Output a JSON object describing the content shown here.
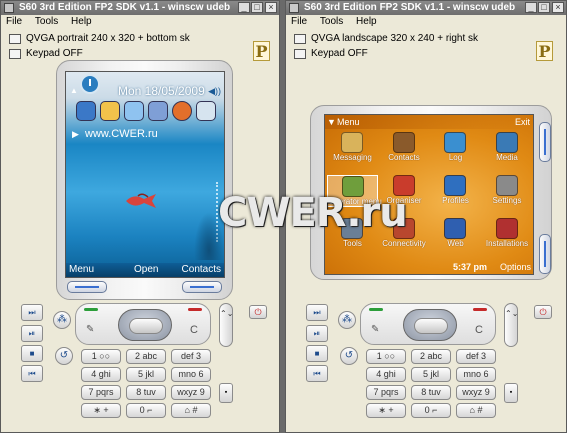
{
  "colors": {
    "titlebar": "#7a7a7a",
    "window_bg": "#ece9d8",
    "softkey_bar": "#0e5e97",
    "menu_orange": "#e08a14"
  },
  "menubar": {
    "file": "File",
    "tools": "Tools",
    "help": "Help"
  },
  "window_controls": {
    "minimize": "_",
    "maximize": "□",
    "close": "×"
  },
  "left_window": {
    "title": "S60 3rd Edition FP2 SDK v1.1 - winscw udeb",
    "mode": "QVGA portrait 240 x 320 + bottom sk",
    "keypad_status": "Keypad OFF",
    "logo": "P",
    "screen": {
      "date": "Mon 18/05/2009",
      "url": "www.CWER.ru",
      "softkeys": {
        "left": "Menu",
        "middle": "Open",
        "right": "Contacts"
      },
      "app_icons": [
        "messaging-icon",
        "contacts-icon",
        "calendar-icon",
        "music-icon",
        "firefox-icon",
        "gallery-icon"
      ]
    }
  },
  "right_window": {
    "title": "S60 3rd Edition FP2 SDK v1.1 - winscw udeb",
    "mode": "QVGA landscape 320 x 240 + right sk",
    "keypad_status": "Keypad OFF",
    "logo": "P",
    "screen": {
      "title": "Menu",
      "exit": "Exit",
      "time": "5:37 pm",
      "options": "Options",
      "selected": "Operator menu",
      "grid": [
        {
          "label": "Messaging",
          "icon": "messaging-icon",
          "color": "#d9b35b"
        },
        {
          "label": "Contacts",
          "icon": "contacts-icon",
          "color": "#8a5a2b"
        },
        {
          "label": "Log",
          "icon": "log-icon",
          "color": "#3a8fd0"
        },
        {
          "label": "Media",
          "icon": "media-icon",
          "color": "#3a7ab5"
        },
        {
          "label": "Operator menu",
          "icon": "operator-icon",
          "color": "#6f9e3c"
        },
        {
          "label": "Organiser",
          "icon": "organiser-icon",
          "color": "#c93c2c"
        },
        {
          "label": "Profiles",
          "icon": "profiles-icon",
          "color": "#2f6fbf"
        },
        {
          "label": "Settings",
          "icon": "settings-icon",
          "color": "#8a8a8a"
        },
        {
          "label": "Tools",
          "icon": "tools-icon",
          "color": "#6a7f96"
        },
        {
          "label": "Connectivity",
          "icon": "connectivity-icon",
          "color": "#b8472e"
        },
        {
          "label": "Web",
          "icon": "web-icon",
          "color": "#2f5fb0"
        },
        {
          "label": "Installations",
          "icon": "installations-icon",
          "color": "#b03030"
        }
      ]
    }
  },
  "keypad": {
    "power": "⏻",
    "clear": "C",
    "camera": "▪",
    "volume": "⌃⌄",
    "numbers": [
      "1 ○○",
      "2 abc",
      "def 3",
      "4 ghi",
      "5 jkl",
      "mno 6",
      "7 pqrs",
      "8 tuv",
      "wxyz 9",
      "∗ +",
      "0 ⌐",
      "⌂ #"
    ]
  },
  "watermark": "CWER.ru"
}
